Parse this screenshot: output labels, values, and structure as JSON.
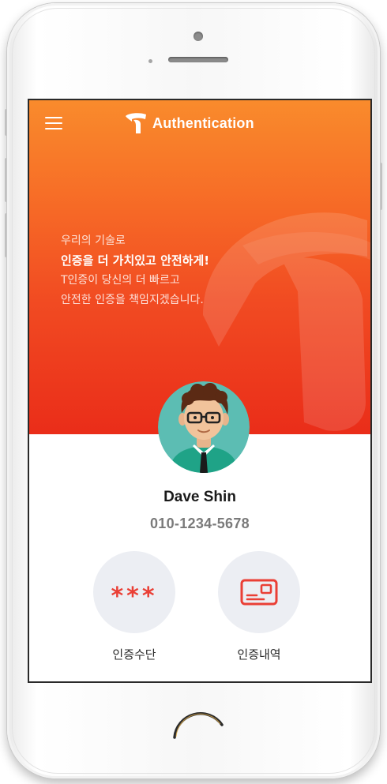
{
  "header": {
    "title": "Authentication",
    "menu_icon": "hamburger-menu-icon",
    "brand_icon": "t-logo-icon"
  },
  "hero": {
    "tagline_line1": "우리의 기술로",
    "tagline_line2": "인증을 더 가치있고 안전하게!",
    "tagline_line3": "T인증이 당신의 더 빠르고",
    "tagline_line4": "안전한 인증을 책임지겠습니다.",
    "gradient_top": "#f98b2c",
    "gradient_bottom": "#ea2d19"
  },
  "profile": {
    "name": "Dave Shin",
    "phone": "010-1234-5678",
    "avatar_icon": "user-avatar-icon"
  },
  "actions": [
    {
      "label": "인증수단",
      "icon_text": "***",
      "icon": "password-asterisk-icon"
    },
    {
      "label": "인증내역",
      "icon": "card-history-icon"
    }
  ],
  "colors": {
    "accent": "#ea3f35",
    "action_bg": "#eceef3"
  }
}
